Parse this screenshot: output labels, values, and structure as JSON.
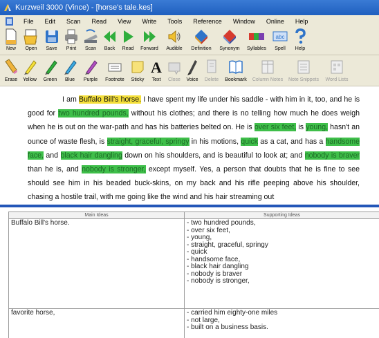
{
  "window": {
    "title": "Kurzweil 3000 (Vince) - [horse's tale.kes]",
    "title_color": "#2a6bd0"
  },
  "menubar": {
    "items": [
      "File",
      "Edit",
      "Scan",
      "Read",
      "View",
      "Write",
      "Tools",
      "Reference",
      "Window",
      "Online",
      "Help"
    ]
  },
  "toolbar_main": {
    "buttons": [
      {
        "label": "New",
        "icon": "new-document-icon"
      },
      {
        "label": "Open",
        "icon": "open-folder-icon"
      },
      {
        "label": "Save",
        "icon": "save-disk-icon"
      },
      {
        "label": "Print",
        "icon": "printer-icon"
      },
      {
        "label": "Scan",
        "icon": "scanner-icon"
      },
      {
        "label": "Back",
        "icon": "back-arrow-icon"
      },
      {
        "label": "Read",
        "icon": "play-icon"
      },
      {
        "label": "Forward",
        "icon": "forward-arrow-icon"
      },
      {
        "label": "Audible",
        "icon": "speaker-icon"
      },
      {
        "label": "Definition",
        "icon": "definition-book-icon"
      },
      {
        "label": "Synonym",
        "icon": "synonym-book-icon"
      },
      {
        "label": "Syllables",
        "icon": "syllables-icon"
      },
      {
        "label": "Spell",
        "icon": "spell-icon"
      },
      {
        "label": "Help",
        "icon": "question-mark-icon"
      }
    ]
  },
  "toolbar_study": {
    "buttons": [
      {
        "label": "Erase",
        "icon": "eraser-icon",
        "enabled": true
      },
      {
        "label": "Yellow",
        "icon": "yellow-highlighter-icon",
        "enabled": true
      },
      {
        "label": "Green",
        "icon": "green-highlighter-icon",
        "enabled": true
      },
      {
        "label": "Blue",
        "icon": "blue-highlighter-icon",
        "enabled": true
      },
      {
        "label": "Purple",
        "icon": "purple-highlighter-icon",
        "enabled": true
      },
      {
        "label": "Footnote",
        "icon": "footnote-icon",
        "enabled": true
      },
      {
        "label": "Sticky",
        "icon": "sticky-note-icon",
        "enabled": true
      },
      {
        "label": "Text",
        "icon": "text-icon",
        "enabled": true
      },
      {
        "label": "Close",
        "icon": "close-note-icon",
        "enabled": false
      },
      {
        "label": "Voice",
        "icon": "voice-pen-icon",
        "enabled": true
      },
      {
        "label": "Delete",
        "icon": "delete-note-icon",
        "enabled": false
      },
      {
        "label": "Bookmark",
        "icon": "bookmark-icon",
        "enabled": true
      },
      {
        "label": "Column Notes",
        "icon": "column-notes-icon",
        "enabled": false
      },
      {
        "label": "Note Snippets",
        "icon": "note-snippets-icon",
        "enabled": false
      },
      {
        "label": "Word Lists",
        "icon": "word-lists-icon",
        "enabled": false
      }
    ]
  },
  "colors": {
    "highlight_yellow": "#f5e03a",
    "highlight_green": "#3fbf4a",
    "pane_divider": "#2356b8"
  },
  "document": {
    "segments": [
      {
        "text": "I am ",
        "hl": ""
      },
      {
        "text": "Buffalo Bill's horse.",
        "hl": "yellow"
      },
      {
        "text": " I have spent my life under his saddle - with him in it, too, and he is good for ",
        "hl": ""
      },
      {
        "text": "two hundred pounds,",
        "hl": "green"
      },
      {
        "text": " without his clothes; and there is no telling how much he does weigh when he is out on the war-path and has his batteries belted on. He is ",
        "hl": ""
      },
      {
        "text": "over six feet,",
        "hl": "green"
      },
      {
        "text": " is ",
        "hl": ""
      },
      {
        "text": "young,",
        "hl": "green"
      },
      {
        "text": " hasn't an ounce of waste flesh, is ",
        "hl": ""
      },
      {
        "text": "straight, graceful, springy",
        "hl": "green"
      },
      {
        "text": " in his motions, ",
        "hl": ""
      },
      {
        "text": "quick",
        "hl": "green"
      },
      {
        "text": " as a cat, and has a ",
        "hl": ""
      },
      {
        "text": "handsome face,",
        "hl": "green"
      },
      {
        "text": " and ",
        "hl": ""
      },
      {
        "text": "black hair dangling",
        "hl": "green"
      },
      {
        "text": " down on his shoulders, and is beautiful to look at; and ",
        "hl": ""
      },
      {
        "text": "nobody is braver",
        "hl": "green"
      },
      {
        "text": " than he is, and ",
        "hl": ""
      },
      {
        "text": "nobody is stronger,",
        "hl": "green"
      },
      {
        "text": " except myself. Yes, a person that doubts that he is fine to see should see him in his beaded buck-skins, on my back and his rifle peeping above his shoulder, chasing a hostile trail, with me going like the wind and his hair streaming out",
        "hl": ""
      }
    ]
  },
  "notes_table": {
    "headers": {
      "main": "Main Ideas",
      "supporting": "Supporting Ideas"
    },
    "rows": [
      {
        "main": "Buffalo Bill's horse.",
        "supporting": [
          "- two hundred pounds,",
          "- over six feet,",
          "- young,",
          "- straight, graceful, springy",
          "- quick",
          "- handsome face,",
          "- black hair dangling",
          "- nobody is braver",
          "- nobody is stronger,"
        ]
      },
      {
        "main": "favorite horse,",
        "supporting": [
          "- carried him eighty-one miles",
          "- not large,",
          "- built on a business basis."
        ]
      }
    ]
  }
}
